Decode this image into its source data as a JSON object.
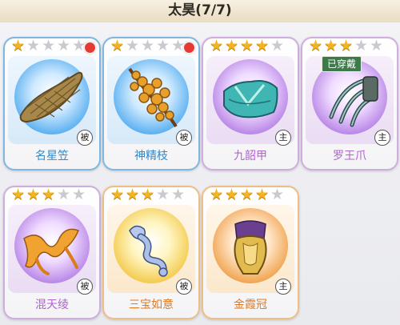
{
  "header": {
    "title": "太昊(7/7)"
  },
  "items": [
    {
      "name": "名星笠",
      "stars": 1,
      "max_stars": 5,
      "rarity": "blue",
      "orb": "blue",
      "tag": "被",
      "red_dot": true,
      "equipped": "",
      "icon": "straw-hat-icon"
    },
    {
      "name": "神精枝",
      "stars": 1,
      "max_stars": 5,
      "rarity": "blue",
      "orb": "blue",
      "tag": "被",
      "red_dot": true,
      "equipped": "",
      "icon": "golden-branch-icon"
    },
    {
      "name": "九韶甲",
      "stars": 4,
      "max_stars": 5,
      "rarity": "purple",
      "orb": "purple",
      "tag": "主",
      "red_dot": false,
      "equipped": "",
      "icon": "jade-armor-icon"
    },
    {
      "name": "罗王爪",
      "stars": 3,
      "max_stars": 5,
      "rarity": "purple",
      "orb": "purple",
      "tag": "主",
      "red_dot": false,
      "equipped": "已穿戴",
      "icon": "claw-icon"
    },
    {
      "name": "混天绫",
      "stars": 3,
      "max_stars": 5,
      "rarity": "purple",
      "orb": "purple",
      "tag": "被",
      "red_dot": false,
      "equipped": "",
      "icon": "silk-ribbon-icon"
    },
    {
      "name": "三宝如意",
      "stars": 3,
      "max_stars": 5,
      "rarity": "orange",
      "orb": "gold",
      "tag": "被",
      "red_dot": false,
      "equipped": "",
      "icon": "ruyi-scepter-icon"
    },
    {
      "name": "金霞冠",
      "stars": 4,
      "max_stars": 5,
      "rarity": "orange",
      "orb": "orange",
      "tag": "主",
      "red_dot": false,
      "equipped": "",
      "icon": "gold-crown-icon"
    }
  ]
}
